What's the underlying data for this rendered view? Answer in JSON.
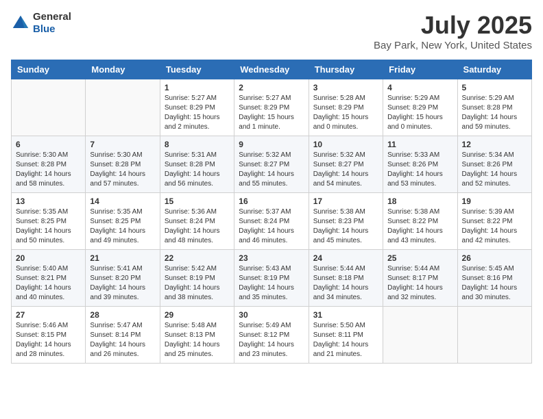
{
  "header": {
    "logo": {
      "general": "General",
      "blue": "Blue"
    },
    "title": "July 2025",
    "subtitle": "Bay Park, New York, United States"
  },
  "calendar": {
    "days_of_week": [
      "Sunday",
      "Monday",
      "Tuesday",
      "Wednesday",
      "Thursday",
      "Friday",
      "Saturday"
    ],
    "weeks": [
      [
        {
          "day": "",
          "info": ""
        },
        {
          "day": "",
          "info": ""
        },
        {
          "day": "1",
          "info": "Sunrise: 5:27 AM\nSunset: 8:29 PM\nDaylight: 15 hours\nand 2 minutes."
        },
        {
          "day": "2",
          "info": "Sunrise: 5:27 AM\nSunset: 8:29 PM\nDaylight: 15 hours\nand 1 minute."
        },
        {
          "day": "3",
          "info": "Sunrise: 5:28 AM\nSunset: 8:29 PM\nDaylight: 15 hours\nand 0 minutes."
        },
        {
          "day": "4",
          "info": "Sunrise: 5:29 AM\nSunset: 8:29 PM\nDaylight: 15 hours\nand 0 minutes."
        },
        {
          "day": "5",
          "info": "Sunrise: 5:29 AM\nSunset: 8:28 PM\nDaylight: 14 hours\nand 59 minutes."
        }
      ],
      [
        {
          "day": "6",
          "info": "Sunrise: 5:30 AM\nSunset: 8:28 PM\nDaylight: 14 hours\nand 58 minutes."
        },
        {
          "day": "7",
          "info": "Sunrise: 5:30 AM\nSunset: 8:28 PM\nDaylight: 14 hours\nand 57 minutes."
        },
        {
          "day": "8",
          "info": "Sunrise: 5:31 AM\nSunset: 8:28 PM\nDaylight: 14 hours\nand 56 minutes."
        },
        {
          "day": "9",
          "info": "Sunrise: 5:32 AM\nSunset: 8:27 PM\nDaylight: 14 hours\nand 55 minutes."
        },
        {
          "day": "10",
          "info": "Sunrise: 5:32 AM\nSunset: 8:27 PM\nDaylight: 14 hours\nand 54 minutes."
        },
        {
          "day": "11",
          "info": "Sunrise: 5:33 AM\nSunset: 8:26 PM\nDaylight: 14 hours\nand 53 minutes."
        },
        {
          "day": "12",
          "info": "Sunrise: 5:34 AM\nSunset: 8:26 PM\nDaylight: 14 hours\nand 52 minutes."
        }
      ],
      [
        {
          "day": "13",
          "info": "Sunrise: 5:35 AM\nSunset: 8:25 PM\nDaylight: 14 hours\nand 50 minutes."
        },
        {
          "day": "14",
          "info": "Sunrise: 5:35 AM\nSunset: 8:25 PM\nDaylight: 14 hours\nand 49 minutes."
        },
        {
          "day": "15",
          "info": "Sunrise: 5:36 AM\nSunset: 8:24 PM\nDaylight: 14 hours\nand 48 minutes."
        },
        {
          "day": "16",
          "info": "Sunrise: 5:37 AM\nSunset: 8:24 PM\nDaylight: 14 hours\nand 46 minutes."
        },
        {
          "day": "17",
          "info": "Sunrise: 5:38 AM\nSunset: 8:23 PM\nDaylight: 14 hours\nand 45 minutes."
        },
        {
          "day": "18",
          "info": "Sunrise: 5:38 AM\nSunset: 8:22 PM\nDaylight: 14 hours\nand 43 minutes."
        },
        {
          "day": "19",
          "info": "Sunrise: 5:39 AM\nSunset: 8:22 PM\nDaylight: 14 hours\nand 42 minutes."
        }
      ],
      [
        {
          "day": "20",
          "info": "Sunrise: 5:40 AM\nSunset: 8:21 PM\nDaylight: 14 hours\nand 40 minutes."
        },
        {
          "day": "21",
          "info": "Sunrise: 5:41 AM\nSunset: 8:20 PM\nDaylight: 14 hours\nand 39 minutes."
        },
        {
          "day": "22",
          "info": "Sunrise: 5:42 AM\nSunset: 8:19 PM\nDaylight: 14 hours\nand 38 minutes."
        },
        {
          "day": "23",
          "info": "Sunrise: 5:43 AM\nSunset: 8:19 PM\nDaylight: 14 hours\nand 35 minutes."
        },
        {
          "day": "24",
          "info": "Sunrise: 5:44 AM\nSunset: 8:18 PM\nDaylight: 14 hours\nand 34 minutes."
        },
        {
          "day": "25",
          "info": "Sunrise: 5:44 AM\nSunset: 8:17 PM\nDaylight: 14 hours\nand 32 minutes."
        },
        {
          "day": "26",
          "info": "Sunrise: 5:45 AM\nSunset: 8:16 PM\nDaylight: 14 hours\nand 30 minutes."
        }
      ],
      [
        {
          "day": "27",
          "info": "Sunrise: 5:46 AM\nSunset: 8:15 PM\nDaylight: 14 hours\nand 28 minutes."
        },
        {
          "day": "28",
          "info": "Sunrise: 5:47 AM\nSunset: 8:14 PM\nDaylight: 14 hours\nand 26 minutes."
        },
        {
          "day": "29",
          "info": "Sunrise: 5:48 AM\nSunset: 8:13 PM\nDaylight: 14 hours\nand 25 minutes."
        },
        {
          "day": "30",
          "info": "Sunrise: 5:49 AM\nSunset: 8:12 PM\nDaylight: 14 hours\nand 23 minutes."
        },
        {
          "day": "31",
          "info": "Sunrise: 5:50 AM\nSunset: 8:11 PM\nDaylight: 14 hours\nand 21 minutes."
        },
        {
          "day": "",
          "info": ""
        },
        {
          "day": "",
          "info": ""
        }
      ]
    ]
  }
}
